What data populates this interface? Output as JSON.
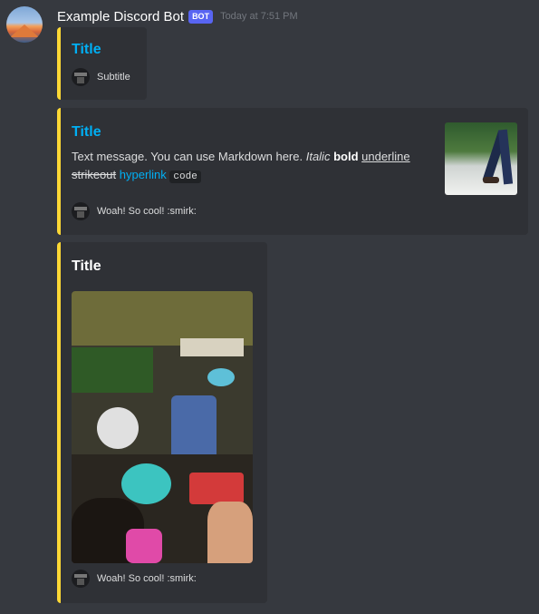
{
  "message": {
    "username": "Example Discord Bot",
    "bot_tag": "BOT",
    "timestamp": "Today at 7:51 PM"
  },
  "embeds": [
    {
      "title": "Title",
      "author_name": "Subtitle"
    },
    {
      "title": "Title",
      "description": {
        "plain": "Text message. You can use Markdown here.",
        "italic": "Italic",
        "bold": "bold",
        "underline": "underline",
        "strikeout": "strikeout",
        "link": "hyperlink",
        "code": "code"
      },
      "footer": "Woah! So cool! :smirk:"
    },
    {
      "title": "Title",
      "footer": "Woah! So cool! :smirk:"
    }
  ],
  "colors": {
    "background": "#36393f",
    "embed_bg": "#2f3136",
    "embed_border": "#fdd835",
    "title_link": "#00aff4",
    "bot_tag": "#5865f2"
  },
  "icons": [
    "avatar-image",
    "footer-icon",
    "thumbnail-image",
    "embed-image"
  ]
}
